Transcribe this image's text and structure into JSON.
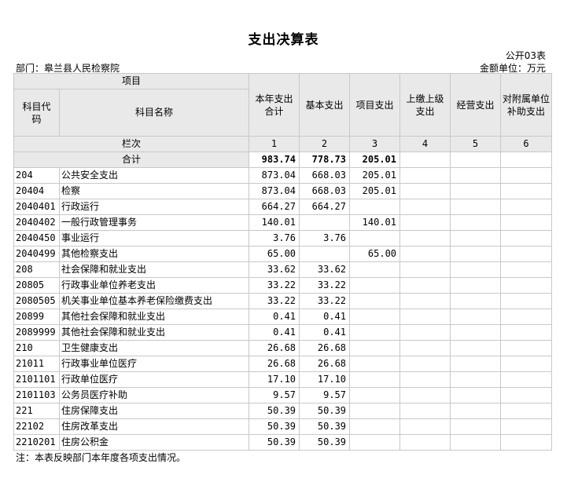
{
  "title": "支出决算表",
  "form_code": "公开03表",
  "department": "部门：皋兰县人民检察院",
  "unit": "金额单位：万元",
  "header": {
    "project": "项目",
    "code": "科目代码",
    "name": "科目名称",
    "cols": [
      "本年支出合计",
      "基本支出",
      "项目支出",
      "上缴上级支出",
      "经营支出",
      "对附属单位补助支出"
    ],
    "row_label": "栏次",
    "col_numbers": [
      "1",
      "2",
      "3",
      "4",
      "5",
      "6"
    ]
  },
  "total": {
    "label": "合计",
    "c1": "983.74",
    "c2": "778.73",
    "c3": "205.01"
  },
  "rows": [
    {
      "code": "204",
      "name": "公共安全支出",
      "c1": "873.04",
      "c2": "668.03",
      "c3": "205.01"
    },
    {
      "code": "20404",
      "name": "检察",
      "c1": "873.04",
      "c2": "668.03",
      "c3": "205.01"
    },
    {
      "code": "2040401",
      "name": "行政运行",
      "c1": "664.27",
      "c2": "664.27",
      "c3": ""
    },
    {
      "code": "2040402",
      "name": "一般行政管理事务",
      "c1": "140.01",
      "c2": "",
      "c3": "140.01"
    },
    {
      "code": "2040450",
      "name": "事业运行",
      "c1": "3.76",
      "c2": "3.76",
      "c3": ""
    },
    {
      "code": "2040499",
      "name": "其他检察支出",
      "c1": "65.00",
      "c2": "",
      "c3": "65.00"
    },
    {
      "code": "208",
      "name": "社会保障和就业支出",
      "c1": "33.62",
      "c2": "33.62",
      "c3": ""
    },
    {
      "code": "20805",
      "name": "行政事业单位养老支出",
      "c1": "33.22",
      "c2": "33.22",
      "c3": ""
    },
    {
      "code": "2080505",
      "name": "机关事业单位基本养老保险缴费支出",
      "c1": "33.22",
      "c2": "33.22",
      "c3": ""
    },
    {
      "code": "20899",
      "name": "其他社会保障和就业支出",
      "c1": "0.41",
      "c2": "0.41",
      "c3": ""
    },
    {
      "code": "2089999",
      "name": "其他社会保障和就业支出",
      "c1": "0.41",
      "c2": "0.41",
      "c3": ""
    },
    {
      "code": "210",
      "name": "卫生健康支出",
      "c1": "26.68",
      "c2": "26.68",
      "c3": ""
    },
    {
      "code": "21011",
      "name": "行政事业单位医疗",
      "c1": "26.68",
      "c2": "26.68",
      "c3": ""
    },
    {
      "code": "2101101",
      "name": "行政单位医疗",
      "c1": "17.10",
      "c2": "17.10",
      "c3": ""
    },
    {
      "code": "2101103",
      "name": "公务员医疗补助",
      "c1": "9.57",
      "c2": "9.57",
      "c3": ""
    },
    {
      "code": "221",
      "name": "住房保障支出",
      "c1": "50.39",
      "c2": "50.39",
      "c3": ""
    },
    {
      "code": "22102",
      "name": "住房改革支出",
      "c1": "50.39",
      "c2": "50.39",
      "c3": ""
    },
    {
      "code": "2210201",
      "name": "住房公积金",
      "c1": "50.39",
      "c2": "50.39",
      "c3": ""
    }
  ],
  "note": "注：本表反映部门本年度各项支出情况。"
}
